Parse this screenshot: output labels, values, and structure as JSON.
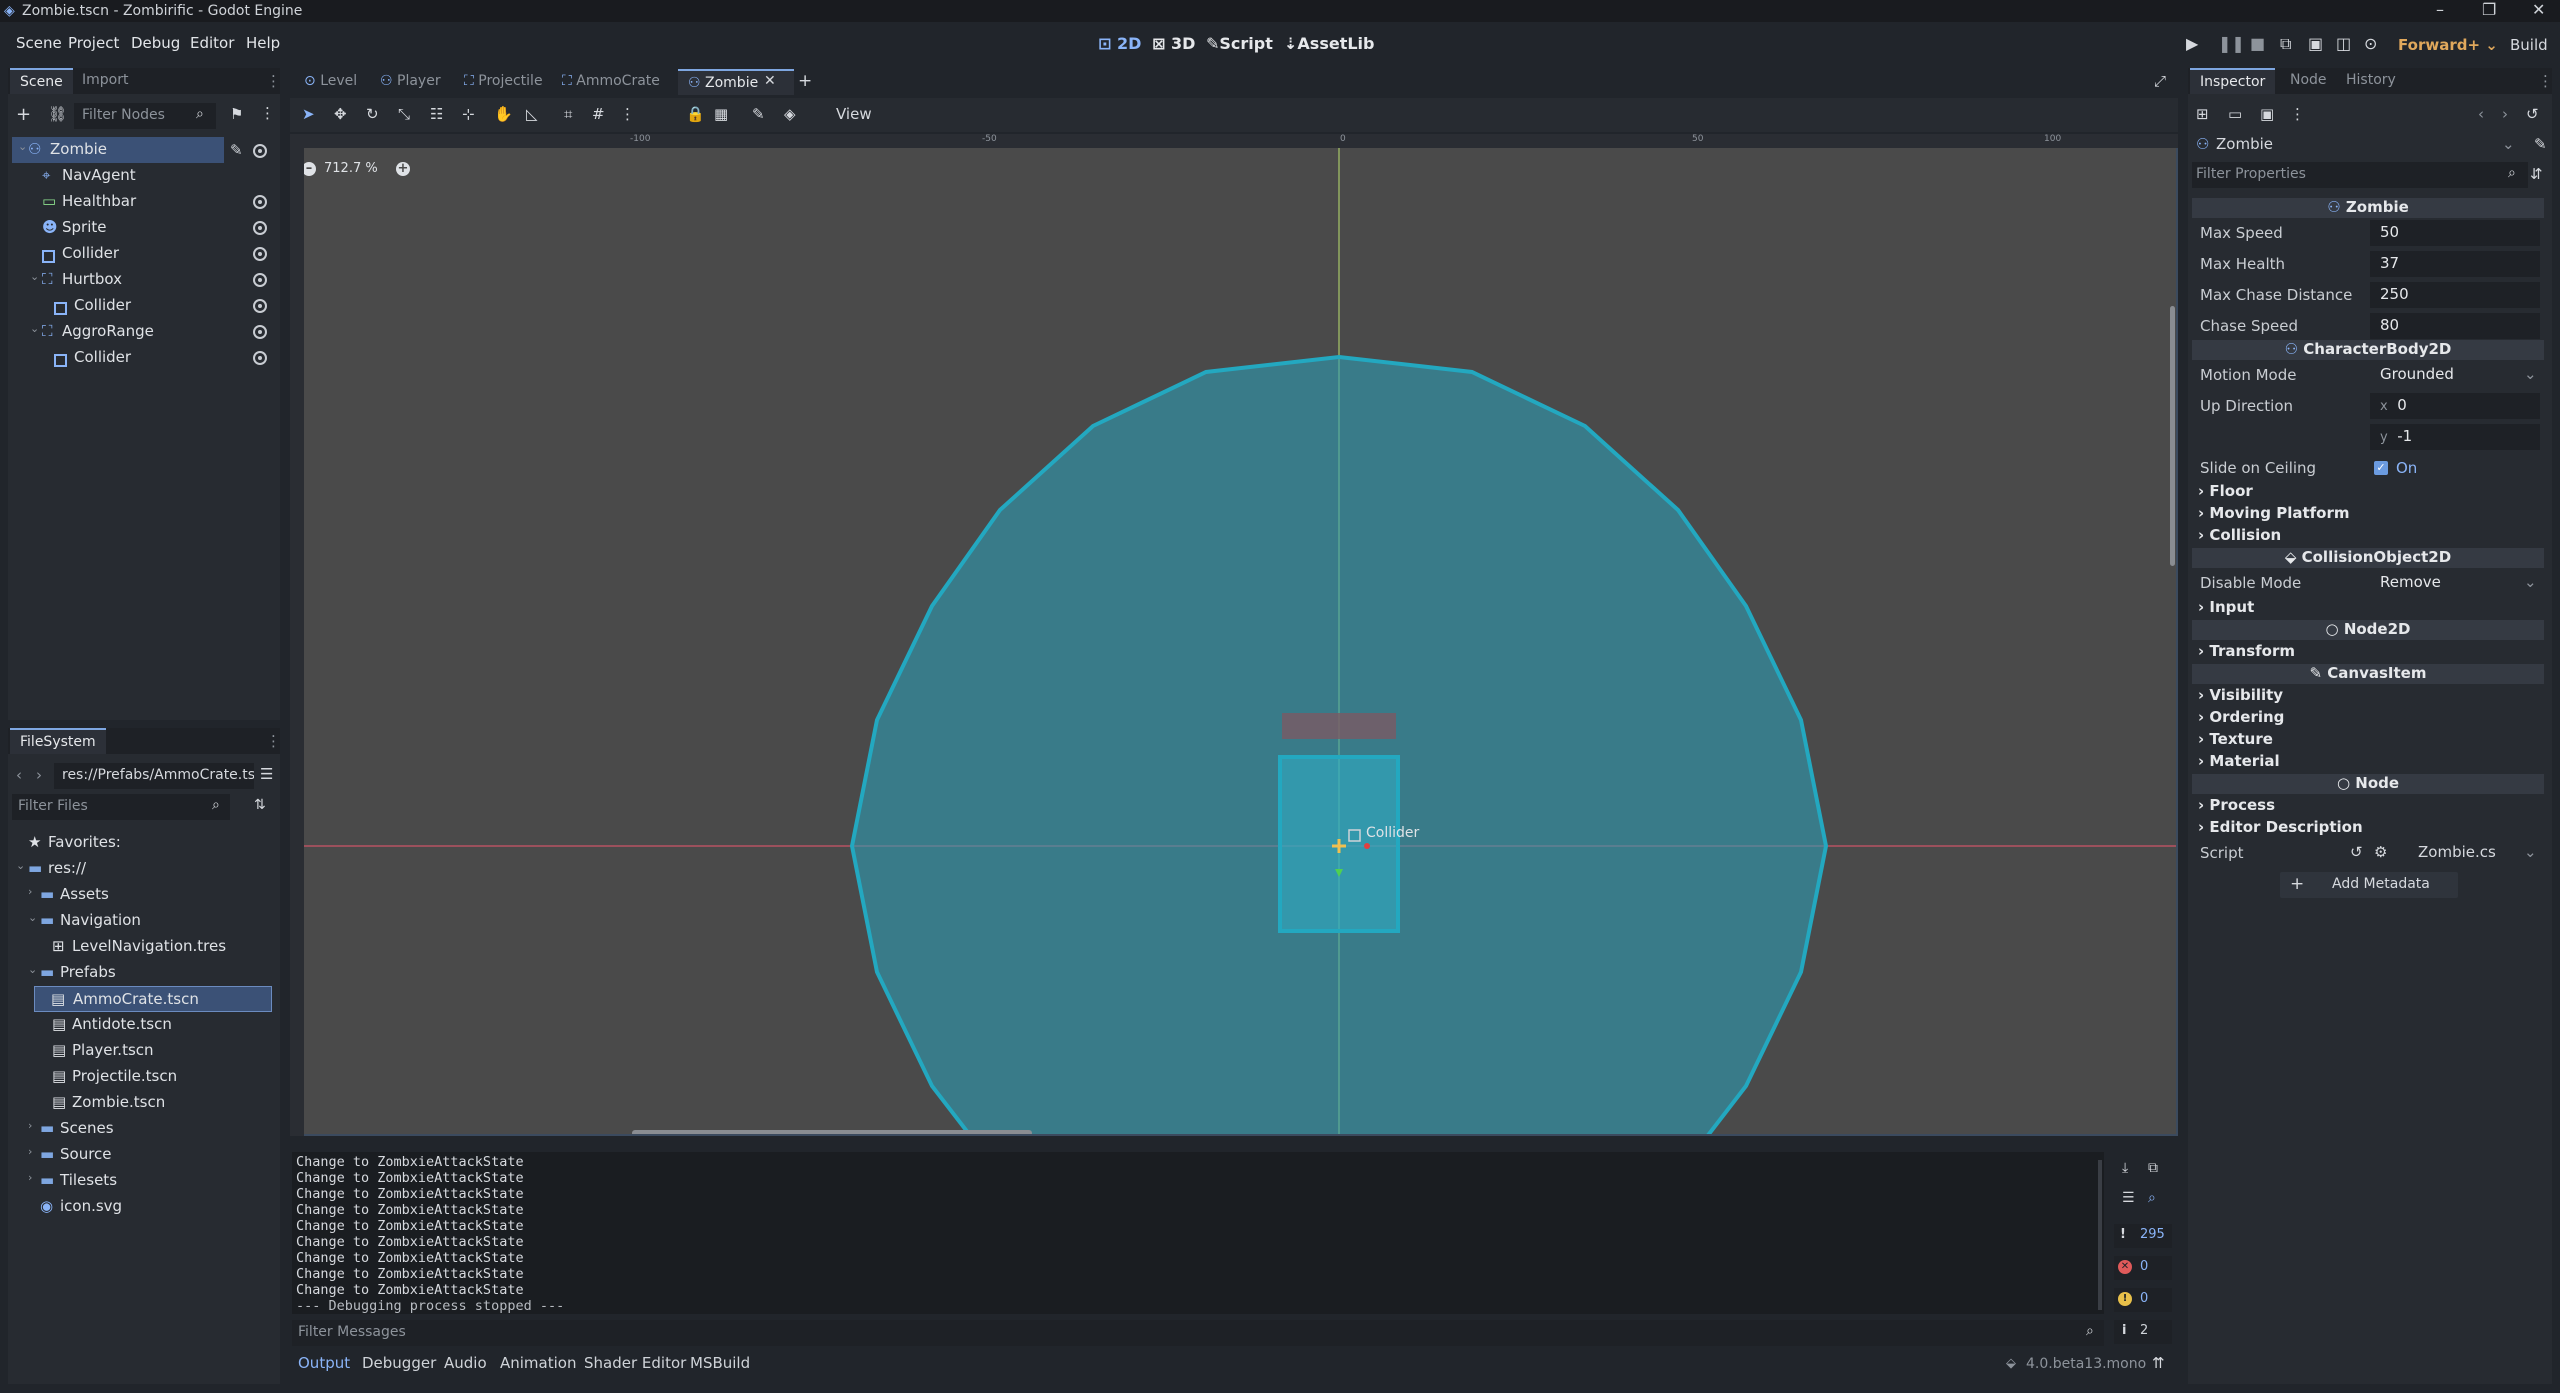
{
  "window": {
    "title": "Zombie.tscn - Zombirific - Godot Engine"
  },
  "menu": [
    "Scene",
    "Project",
    "Debug",
    "Editor",
    "Help"
  ],
  "workspaces": [
    "2D",
    "3D",
    "Script",
    "AssetLib"
  ],
  "run_area": {
    "renderer": "Forward+",
    "build": "Build"
  },
  "scene_dock": {
    "tabs": [
      "Scene",
      "Import"
    ],
    "filter_placeholder": "Filter Nodes",
    "nodes": [
      {
        "name": "Zombie",
        "depth": 0
      },
      {
        "name": "NavAgent",
        "depth": 1
      },
      {
        "name": "Healthbar",
        "depth": 1
      },
      {
        "name": "Sprite",
        "depth": 1
      },
      {
        "name": "Collider",
        "depth": 1
      },
      {
        "name": "Hurtbox",
        "depth": 1
      },
      {
        "name": "Collider",
        "depth": 2
      },
      {
        "name": "AggroRange",
        "depth": 1
      },
      {
        "name": "Collider",
        "depth": 2
      }
    ]
  },
  "filesystem": {
    "tab": "FileSystem",
    "path": "res://Prefabs/AmmoCrate.ts",
    "filter_placeholder": "Filter Files",
    "items": [
      {
        "name": "Favorites:",
        "depth": 0
      },
      {
        "name": "res://",
        "depth": 0
      },
      {
        "name": "Assets",
        "depth": 1
      },
      {
        "name": "Navigation",
        "depth": 1
      },
      {
        "name": "LevelNavigation.tres",
        "depth": 2
      },
      {
        "name": "Prefabs",
        "depth": 1
      },
      {
        "name": "AmmoCrate.tscn",
        "depth": 2,
        "selected": true
      },
      {
        "name": "Antidote.tscn",
        "depth": 2
      },
      {
        "name": "Player.tscn",
        "depth": 2
      },
      {
        "name": "Projectile.tscn",
        "depth": 2
      },
      {
        "name": "Zombie.tscn",
        "depth": 2
      },
      {
        "name": "Scenes",
        "depth": 1
      },
      {
        "name": "Source",
        "depth": 1
      },
      {
        "name": "Tilesets",
        "depth": 1
      },
      {
        "name": "icon.svg",
        "depth": 1
      }
    ]
  },
  "scene_tabs": [
    "Level",
    "Player",
    "Projectile",
    "AmmoCrate",
    "Zombie"
  ],
  "toolbar": {
    "view_label": "View"
  },
  "viewport": {
    "zoom": "712.7 %",
    "ruler_ticks": [
      "-100",
      "-50",
      "0",
      "50",
      "100"
    ],
    "node_label": "Collider"
  },
  "output": {
    "lines": [
      "Change to ZombxieAttackState",
      "Change to ZombxieAttackState",
      "Change to ZombxieAttackState",
      "Change to ZombxieAttackState",
      "Change to ZombxieAttackState",
      "Change to ZombxieAttackState",
      "Change to ZombxieAttackState",
      "Change to ZombxieAttackState",
      "Change to ZombxieAttackState",
      "--- Debugging process stopped ---"
    ],
    "filter_placeholder": "Filter Messages",
    "counts": {
      "messages": "295",
      "errors": "0",
      "warnings": "0",
      "info": "2"
    }
  },
  "bottom_tabs": [
    "Output",
    "Debugger",
    "Audio",
    "Animation",
    "Shader Editor",
    "MSBuild"
  ],
  "version": "4.0.beta13.mono",
  "inspector": {
    "tabs": [
      "Inspector",
      "Node",
      "History"
    ],
    "object": "Zombie",
    "filter_placeholder": "Filter Properties",
    "sections": {
      "zombie": "Zombie",
      "characterbody": "CharacterBody2D",
      "collisionobject": "CollisionObject2D",
      "node2d": "Node2D",
      "canvasitem": "CanvasItem",
      "node": "Node"
    },
    "props": {
      "max_speed": {
        "label": "Max Speed",
        "value": "50"
      },
      "max_health": {
        "label": "Max Health",
        "value": "37"
      },
      "max_chase": {
        "label": "Max Chase Distance",
        "value": "250"
      },
      "chase_speed": {
        "label": "Chase Speed",
        "value": "80"
      },
      "motion_mode": {
        "label": "Motion Mode",
        "value": "Grounded"
      },
      "up_direction": {
        "label": "Up Direction",
        "x": "0",
        "y": "-1"
      },
      "slide_on_ceiling": {
        "label": "Slide on Ceiling",
        "value": "On"
      },
      "disable_mode": {
        "label": "Disable Mode",
        "value": "Remove"
      },
      "script": {
        "label": "Script",
        "value": "Zombie.cs"
      }
    },
    "groups": {
      "floor": "Floor",
      "moving": "Moving Platform",
      "collision": "Collision",
      "input": "Input",
      "transform": "Transform",
      "visibility": "Visibility",
      "ordering": "Ordering",
      "texture": "Texture",
      "material": "Material",
      "process": "Process",
      "editor_desc": "Editor Description"
    },
    "add_metadata": "Add Metadata"
  },
  "colors": {
    "accent": "#8ab4f8",
    "aggro": "#2ea4b8",
    "selected_row": "#3b5176"
  }
}
